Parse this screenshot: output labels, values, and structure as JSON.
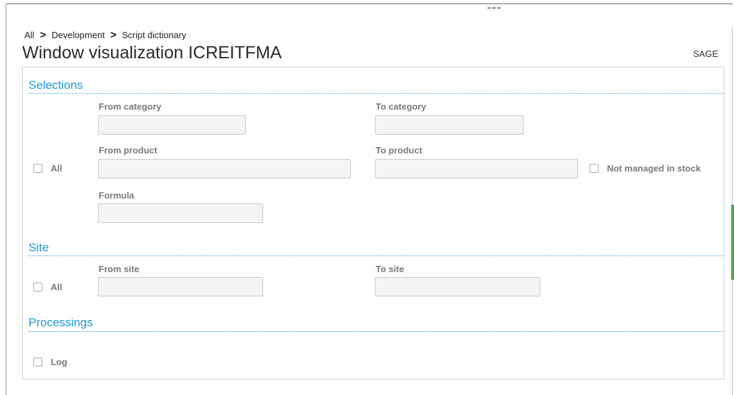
{
  "breadcrumb": {
    "items": [
      "All",
      "Development",
      "Script dictionary"
    ],
    "separator": ">"
  },
  "page": {
    "title": "Window visualization ICREITFMA",
    "company": "SAGE"
  },
  "sections": {
    "selections": {
      "title": "Selections",
      "all_checkbox": {
        "label": "All",
        "checked": false
      },
      "from_category": {
        "label": "From category",
        "value": ""
      },
      "to_category": {
        "label": "To category",
        "value": ""
      },
      "from_product": {
        "label": "From product",
        "value": ""
      },
      "to_product": {
        "label": "To product",
        "value": ""
      },
      "not_managed_checkbox": {
        "label": "Not managed in stock",
        "checked": false
      },
      "formula": {
        "label": "Formula",
        "value": ""
      }
    },
    "site": {
      "title": "Site",
      "all_checkbox": {
        "label": "All",
        "checked": false
      },
      "from_site": {
        "label": "From site",
        "value": ""
      },
      "to_site": {
        "label": "To site",
        "value": ""
      }
    },
    "processings": {
      "title": "Processings",
      "log_checkbox": {
        "label": "Log",
        "checked": false
      }
    }
  },
  "colors": {
    "section_title": "#1a9ad6",
    "label": "#7a7a7a",
    "input_bg": "#f4f4f4",
    "scroll_indicator": "#3fae49"
  }
}
